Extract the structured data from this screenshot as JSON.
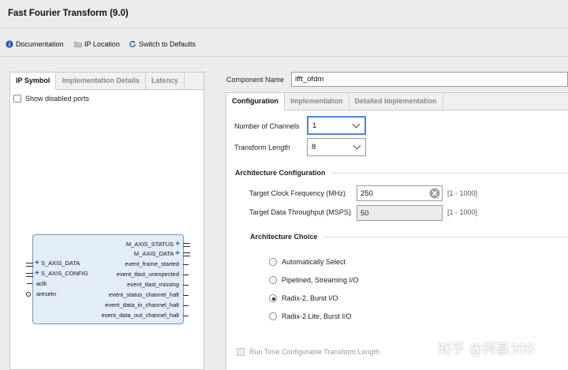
{
  "window": {
    "title": "Fast Fourier Transform (9.0)"
  },
  "toolbar": {
    "documentation": "Documentation",
    "ip_location": "IP Location",
    "switch_defaults": "Switch to Defaults"
  },
  "left_panel": {
    "tabs": [
      "IP Symbol",
      "Implementation Details",
      "Latency"
    ],
    "show_disabled_ports": "Show disabled ports",
    "symbol": {
      "left_ports": [
        "S_AXIS_DATA",
        "S_AXIS_CONFIG",
        "aclk",
        "aresetn"
      ],
      "right_ports": [
        "M_AXIS_STATUS",
        "M_AXIS_DATA",
        "event_frame_started",
        "event_tlast_unexpected",
        "event_tlast_missing",
        "event_status_channel_halt",
        "event_data_in_channel_halt",
        "event_data_out_channel_halt"
      ]
    }
  },
  "component": {
    "label": "Component Name",
    "value": "ifft_ofdm"
  },
  "right_tabs": [
    "Configuration",
    "Implementation",
    "Detailed Implementation"
  ],
  "config": {
    "channels_label": "Number of Channels",
    "channels_value": "1",
    "length_label": "Transform Length",
    "length_value": "8",
    "arch_config_title": "Architecture Configuration",
    "clock_label": "Target Clock Frequency (MHz)",
    "clock_value": "250",
    "clock_range": "[1 - 1000]",
    "throughput_label": "Target Data Throughput (MSPS)",
    "throughput_value": "50",
    "throughput_range": "[1 - 1000]",
    "arch_choice_title": "Architecture Choice",
    "options": [
      "Automatically Select",
      "Pipelined, Streaming I/O",
      "Radix-2, Burst I/O",
      "Radix-2 Lite, Burst I/O"
    ],
    "selected_option": "Radix-2, Burst I/O",
    "runtime_label": "Run Time Configurable Transform Length"
  },
  "watermark": "知乎 @柯基300",
  "colors": {
    "accent": "#4b85d8",
    "info_blue": "#2b5fa8",
    "block_fill": "#e3edf8"
  }
}
